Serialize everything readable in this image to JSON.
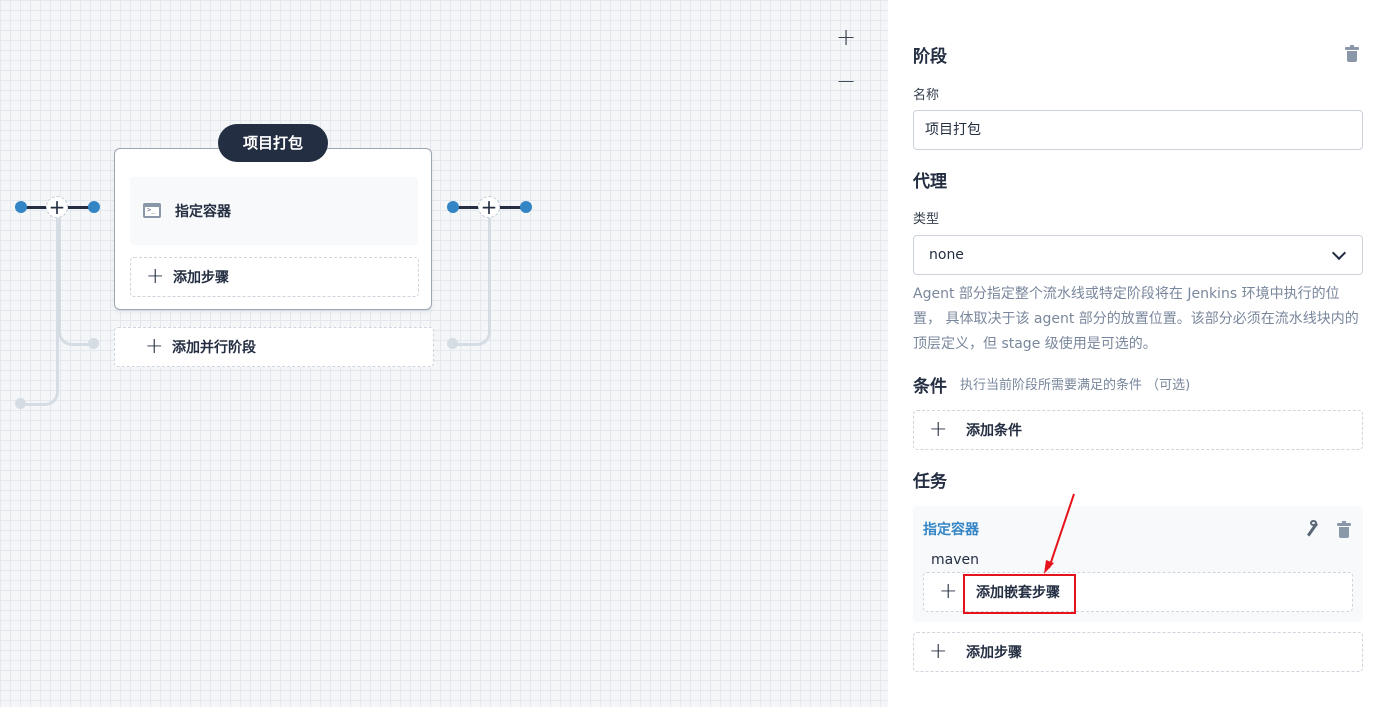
{
  "canvas": {
    "zoom_in": "+",
    "zoom_out": "−",
    "stage": {
      "title": "项目打包",
      "step_label": "指定容器",
      "add_step_label": "添加步骤",
      "add_parallel_label": "添加并行阶段"
    }
  },
  "panel": {
    "stage_section": "阶段",
    "name_label": "名称",
    "name_value": "项目打包",
    "agent_section": "代理",
    "type_label": "类型",
    "type_value": "none",
    "agent_desc": "Agent 部分指定整个流水线或特定阶段将在 Jenkins 环境中执行的位置， 具体取决于该 agent 部分的放置位置。该部分必须在流水线块内的顶层定义，但 stage 级使用是可选的。",
    "condition_section": "条件",
    "condition_desc": "执行当前阶段所需要满足的条件 （可选)",
    "add_condition_label": "添加条件",
    "task_section": "任务",
    "task": {
      "name": "指定容器",
      "value": "maven",
      "add_nested_label": "添加嵌套步骤"
    },
    "add_step_label": "添加步骤"
  },
  "colors": {
    "accent": "#3385c6",
    "dark": "#242e42",
    "highlight": "#e5141c"
  }
}
